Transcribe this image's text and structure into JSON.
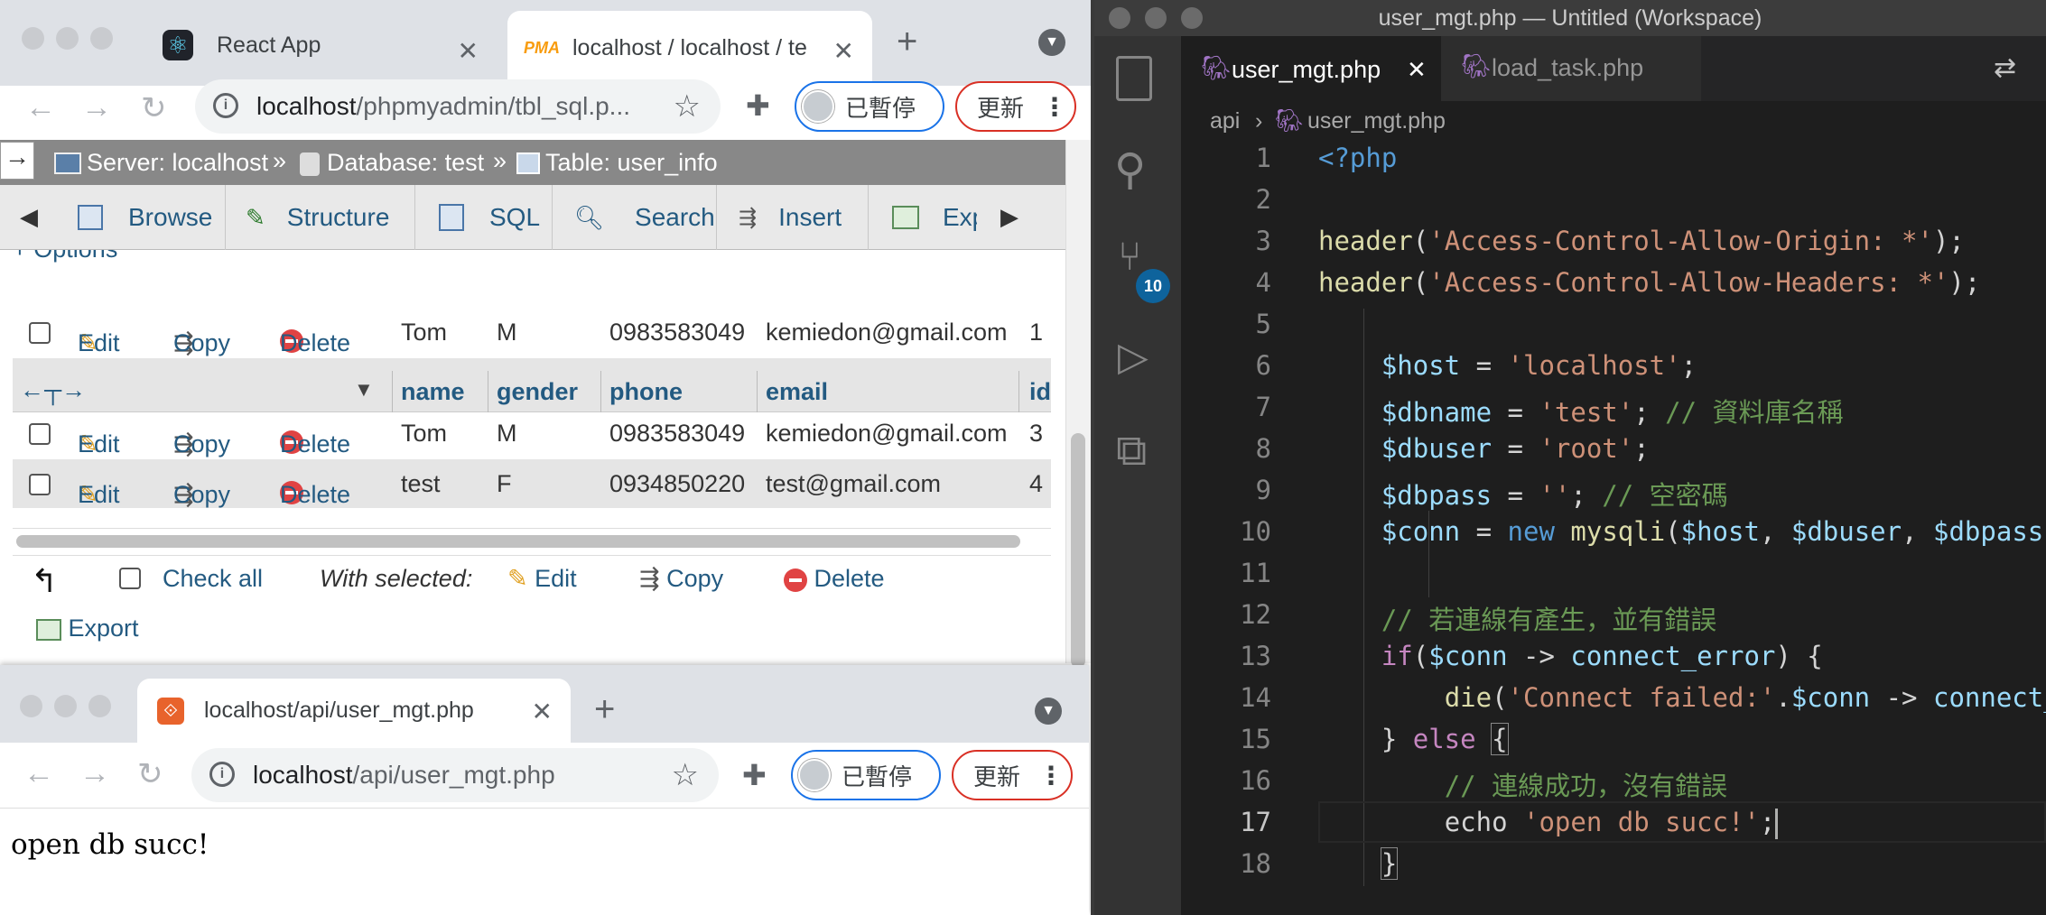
{
  "browser_top": {
    "tabs": [
      {
        "title": "React App"
      },
      {
        "title": "localhost / localhost / te"
      }
    ],
    "url_host": "localhost",
    "url_path": "/phpmyadmin/tbl_sql.p...",
    "paused_label": "已暫停",
    "update_label": "更新"
  },
  "pma": {
    "breadcrumb": {
      "server": "Server: localhost",
      "database": "Database: test",
      "table": "Table: user_info"
    },
    "tabs": [
      "Browse",
      "Structure",
      "SQL",
      "Search",
      "Insert",
      "Exp"
    ],
    "options_label": "+ Options",
    "columns": [
      "name",
      "gender",
      "phone",
      "email",
      "id"
    ],
    "row_actions": {
      "edit": "Edit",
      "copy": "Copy",
      "delete": "Delete"
    },
    "rows": [
      {
        "name": "Tom",
        "gender": "M",
        "phone": "0983583049",
        "email": "kemiedon@gmail.com",
        "id": "1"
      },
      {
        "name": "Tom",
        "gender": "M",
        "phone": "0983583049",
        "email": "kemiedon@gmail.com",
        "id": "3"
      },
      {
        "name": "test",
        "gender": "F",
        "phone": "0934850220",
        "email": "test@gmail.com",
        "id": "4"
      }
    ],
    "check_all": "Check all",
    "with_selected": "With selected:",
    "bulk_edit": "Edit",
    "bulk_copy": "Copy",
    "bulk_delete": "Delete",
    "export": "Export"
  },
  "browser_bottom": {
    "tab_title": "localhost/api/user_mgt.php",
    "url_host": "localhost",
    "url_path": "/api/user_mgt.php",
    "paused_label": "已暫停",
    "update_label": "更新",
    "page_text": "open db succ!"
  },
  "vscode": {
    "window_title": "user_mgt.php — Untitled (Workspace)",
    "tabs": [
      {
        "title": "user_mgt.php"
      },
      {
        "title": "load_task.php"
      }
    ],
    "breadcrumb": {
      "folder": "api",
      "file": "user_mgt.php"
    },
    "scm_badge": "10",
    "line_numbers": [
      "1",
      "2",
      "3",
      "4",
      "5",
      "6",
      "7",
      "8",
      "9",
      "10",
      "11",
      "12",
      "13",
      "14",
      "15",
      "16",
      "17",
      "18"
    ],
    "colors": {
      "editor_bg": "#1e1e1e",
      "activity_bg": "#333333",
      "badge": "#0e639c"
    }
  }
}
